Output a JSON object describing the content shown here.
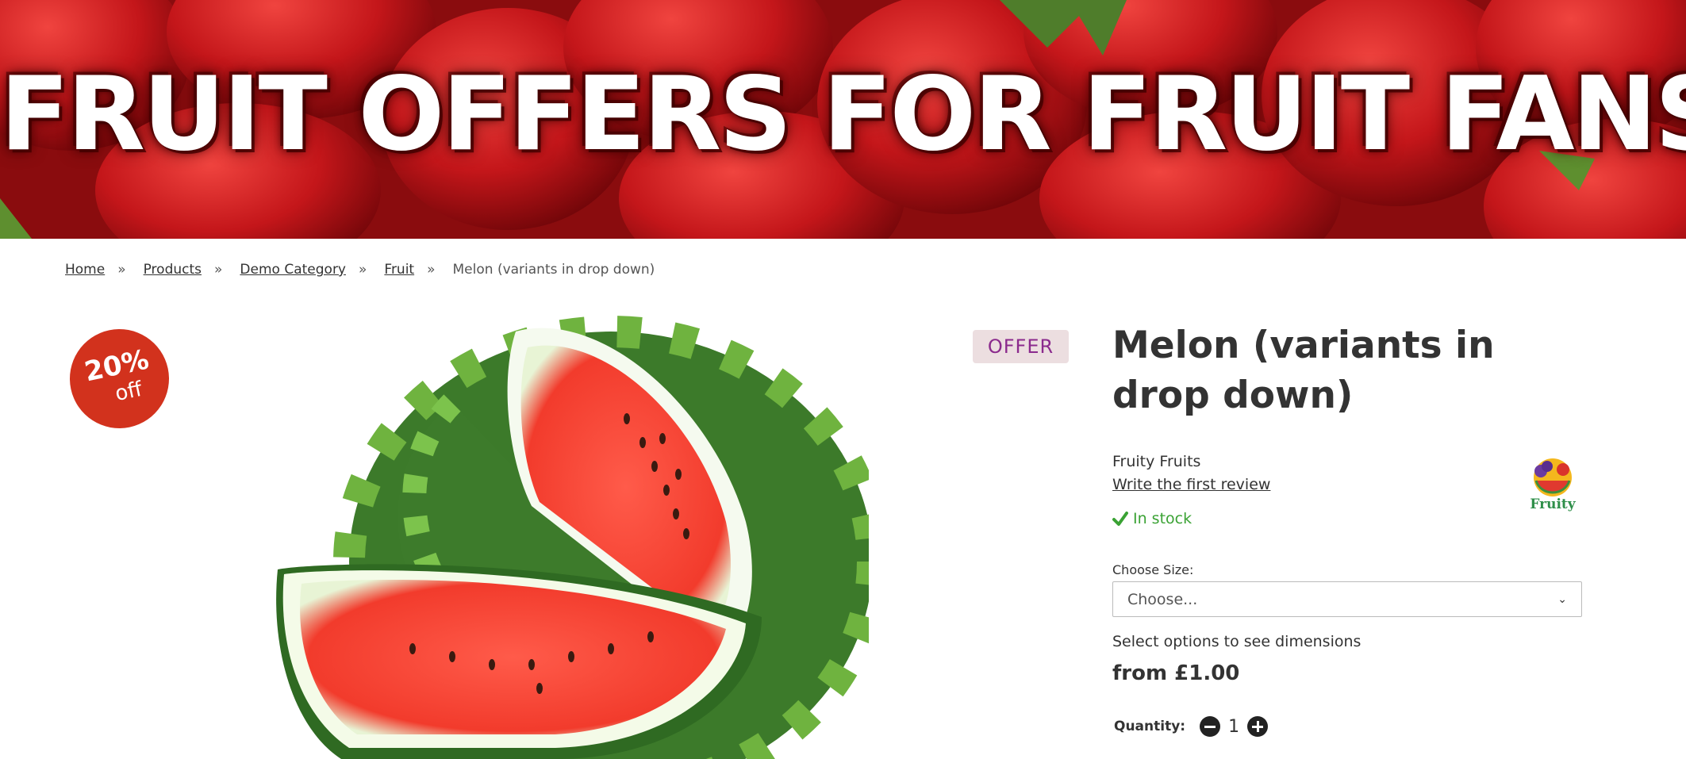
{
  "banner": {
    "title": "FRUIT OFFERS FOR FRUIT FANS"
  },
  "breadcrumb": {
    "items": [
      "Home",
      "Products",
      "Demo Category",
      "Fruit"
    ],
    "separator": "»",
    "current": "Melon (variants in drop down)"
  },
  "product": {
    "discount": {
      "percent": "20%",
      "suffix": "off"
    },
    "offer_badge": "OFFER",
    "title": "Melon (variants in drop down)",
    "brand": "Fruity Fruits",
    "review_link": "Write the first review",
    "stock": "In stock",
    "brand_logo_text": "Fruity",
    "size_label": "Choose Size:",
    "size_select_value": "Choose...",
    "dimensions_text": "Select options to see dimensions",
    "price": "from £1.00",
    "quantity_label": "Quantity:",
    "quantity_value": "1"
  },
  "colors": {
    "discount_red": "#d2321d",
    "offer_bg": "#ecdee0",
    "offer_text": "#8b2a8d",
    "stock_green": "#3aa234"
  }
}
